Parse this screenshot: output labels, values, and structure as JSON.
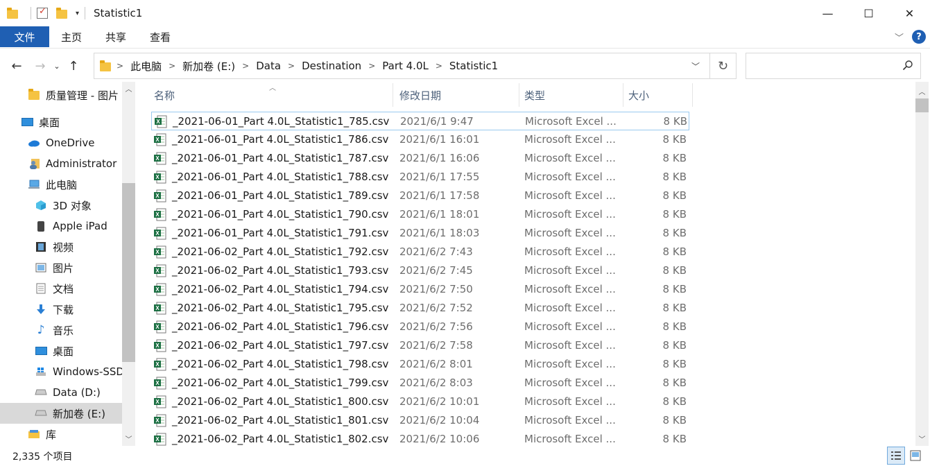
{
  "window": {
    "title": "Statistic1",
    "controls": {
      "minimize": "—",
      "maximize": "☐",
      "close": "✕"
    }
  },
  "ribbon": {
    "tabs": [
      "文件",
      "主页",
      "共享",
      "查看"
    ]
  },
  "nav": {
    "back": "←",
    "forward": "→",
    "recent": "⌄",
    "up": "↑",
    "breadcrumb": [
      "此电脑",
      "新加卷 (E:)",
      "Data",
      "Destination",
      "Part 4.0L",
      "Statistic1"
    ],
    "search_placeholder": ""
  },
  "sidebar": {
    "items": [
      {
        "label": "质量管理 - 图片 - ",
        "icon": "folder-icon",
        "indent": 1
      },
      {
        "label": "桌面",
        "icon": "desktop-icon",
        "indent": 0
      },
      {
        "label": "OneDrive",
        "icon": "onedrive-icon",
        "indent": 1
      },
      {
        "label": "Administrator",
        "icon": "user-icon",
        "indent": 1
      },
      {
        "label": "此电脑",
        "icon": "computer-icon",
        "indent": 1
      },
      {
        "label": "3D 对象",
        "icon": "3d-objects-icon",
        "indent": 2
      },
      {
        "label": "Apple iPad",
        "icon": "ipad-icon",
        "indent": 2
      },
      {
        "label": "视频",
        "icon": "video-icon",
        "indent": 2
      },
      {
        "label": "图片",
        "icon": "pictures-icon",
        "indent": 2
      },
      {
        "label": "文档",
        "icon": "documents-icon",
        "indent": 2
      },
      {
        "label": "下载",
        "icon": "downloads-icon",
        "indent": 2
      },
      {
        "label": "音乐",
        "icon": "music-icon",
        "indent": 2
      },
      {
        "label": "桌面",
        "icon": "desktop-icon",
        "indent": 2
      },
      {
        "label": "Windows-SSD",
        "icon": "drive-icon",
        "indent": 2
      },
      {
        "label": "Data (D:)",
        "icon": "drive-icon",
        "indent": 2
      },
      {
        "label": "新加卷 (E:)",
        "icon": "drive-icon",
        "indent": 2,
        "selected": true
      },
      {
        "label": "库",
        "icon": "library-icon",
        "indent": 1
      }
    ]
  },
  "columns": {
    "name": "名称",
    "date": "修改日期",
    "type": "类型",
    "size": "大小"
  },
  "files": [
    {
      "name": "_2021-06-01_Part 4.0L_Statistic1_785.csv",
      "date": "2021/6/1 9:47",
      "type": "Microsoft Excel ...",
      "size": "8 KB"
    },
    {
      "name": "_2021-06-01_Part 4.0L_Statistic1_786.csv",
      "date": "2021/6/1 16:01",
      "type": "Microsoft Excel ...",
      "size": "8 KB"
    },
    {
      "name": "_2021-06-01_Part 4.0L_Statistic1_787.csv",
      "date": "2021/6/1 16:06",
      "type": "Microsoft Excel ...",
      "size": "8 KB"
    },
    {
      "name": "_2021-06-01_Part 4.0L_Statistic1_788.csv",
      "date": "2021/6/1 17:55",
      "type": "Microsoft Excel ...",
      "size": "8 KB"
    },
    {
      "name": "_2021-06-01_Part 4.0L_Statistic1_789.csv",
      "date": "2021/6/1 17:58",
      "type": "Microsoft Excel ...",
      "size": "8 KB"
    },
    {
      "name": "_2021-06-01_Part 4.0L_Statistic1_790.csv",
      "date": "2021/6/1 18:01",
      "type": "Microsoft Excel ...",
      "size": "8 KB"
    },
    {
      "name": "_2021-06-01_Part 4.0L_Statistic1_791.csv",
      "date": "2021/6/1 18:03",
      "type": "Microsoft Excel ...",
      "size": "8 KB"
    },
    {
      "name": "_2021-06-02_Part 4.0L_Statistic1_792.csv",
      "date": "2021/6/2 7:43",
      "type": "Microsoft Excel ...",
      "size": "8 KB"
    },
    {
      "name": "_2021-06-02_Part 4.0L_Statistic1_793.csv",
      "date": "2021/6/2 7:45",
      "type": "Microsoft Excel ...",
      "size": "8 KB"
    },
    {
      "name": "_2021-06-02_Part 4.0L_Statistic1_794.csv",
      "date": "2021/6/2 7:50",
      "type": "Microsoft Excel ...",
      "size": "8 KB"
    },
    {
      "name": "_2021-06-02_Part 4.0L_Statistic1_795.csv",
      "date": "2021/6/2 7:52",
      "type": "Microsoft Excel ...",
      "size": "8 KB"
    },
    {
      "name": "_2021-06-02_Part 4.0L_Statistic1_796.csv",
      "date": "2021/6/2 7:56",
      "type": "Microsoft Excel ...",
      "size": "8 KB"
    },
    {
      "name": "_2021-06-02_Part 4.0L_Statistic1_797.csv",
      "date": "2021/6/2 7:58",
      "type": "Microsoft Excel ...",
      "size": "8 KB"
    },
    {
      "name": "_2021-06-02_Part 4.0L_Statistic1_798.csv",
      "date": "2021/6/2 8:01",
      "type": "Microsoft Excel ...",
      "size": "8 KB"
    },
    {
      "name": "_2021-06-02_Part 4.0L_Statistic1_799.csv",
      "date": "2021/6/2 8:03",
      "type": "Microsoft Excel ...",
      "size": "8 KB"
    },
    {
      "name": "_2021-06-02_Part 4.0L_Statistic1_800.csv",
      "date": "2021/6/2 10:01",
      "type": "Microsoft Excel ...",
      "size": "8 KB"
    },
    {
      "name": "_2021-06-02_Part 4.0L_Statistic1_801.csv",
      "date": "2021/6/2 10:04",
      "type": "Microsoft Excel ...",
      "size": "8 KB"
    },
    {
      "name": "_2021-06-02_Part 4.0L_Statistic1_802.csv",
      "date": "2021/6/2 10:06",
      "type": "Microsoft Excel ...",
      "size": "8 KB"
    }
  ],
  "status": {
    "item_count": "2,335 个项目"
  },
  "colors": {
    "file_tab": "#1f5fb3",
    "header_text": "#4c607a",
    "excel_green": "#1d7044",
    "focus_border": "#99c9ef"
  }
}
